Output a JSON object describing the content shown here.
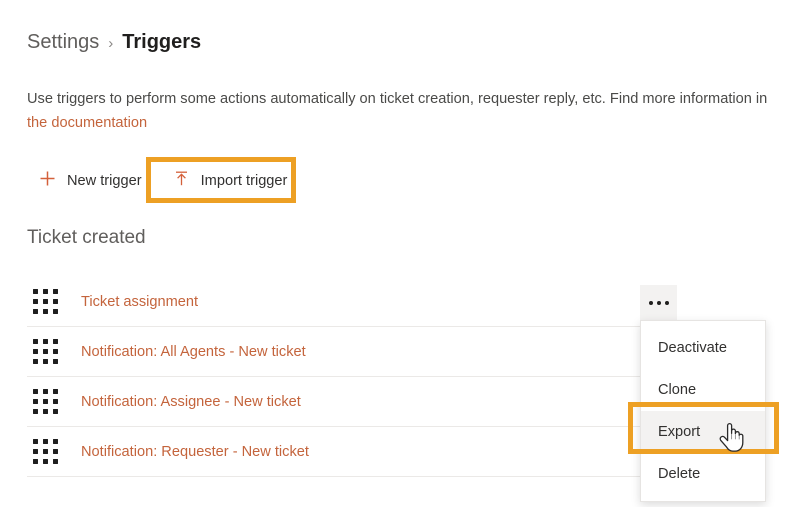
{
  "breadcrumb": {
    "root": "Settings",
    "separator": "›",
    "current": "Triggers"
  },
  "description": {
    "text_before": "Use triggers to perform some actions automatically on ticket creation, requester reply, etc. Find more information in ",
    "link_text": "the documentation"
  },
  "toolbar": {
    "new_trigger_label": "New trigger",
    "import_trigger_label": "Import trigger",
    "new_trigger_icon": "plus-icon",
    "import_trigger_icon": "upload-arrow-icon"
  },
  "section": {
    "title": "Ticket created"
  },
  "list": {
    "rows": [
      {
        "label": "Ticket assignment"
      },
      {
        "label": "Notification: All Agents - New ticket"
      },
      {
        "label": "Notification: Assignee - New ticket"
      },
      {
        "label": "Notification: Requester - New ticket"
      }
    ]
  },
  "row_menu": {
    "trigger_icon": "ellipsis-icon",
    "items": [
      {
        "label": "Deactivate",
        "active": false
      },
      {
        "label": "Clone",
        "active": false
      },
      {
        "label": "Export",
        "active": true
      },
      {
        "label": "Delete",
        "active": false
      }
    ]
  },
  "highlights": [
    {
      "target": "import-trigger-button",
      "color": "#eda024"
    },
    {
      "target": "menu-item-export",
      "color": "#eda024"
    }
  ],
  "colors": {
    "accent_orange": "#c4643c",
    "highlight_orange": "#eda024",
    "text_dark": "#201f1e",
    "text_muted": "#605e5c",
    "divider": "#ebe9e7"
  },
  "cursor": {
    "type": "pointer-hand"
  }
}
